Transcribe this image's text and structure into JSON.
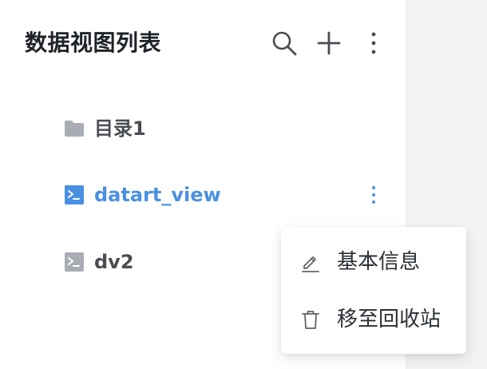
{
  "panel": {
    "title": "数据视图列表"
  },
  "header_actions": [
    {
      "name": "search-icon"
    },
    {
      "name": "plus-icon"
    },
    {
      "name": "more-vertical-icon"
    }
  ],
  "tree": {
    "items": [
      {
        "label": "目录1",
        "icon": "folder-icon",
        "active": false
      },
      {
        "label": "datart_view",
        "icon": "terminal-icon",
        "active": true
      },
      {
        "label": "dv2",
        "icon": "terminal-icon",
        "active": false
      }
    ]
  },
  "context_menu": {
    "items": [
      {
        "label": "基本信息",
        "icon": "edit-icon"
      },
      {
        "label": "移至回收站",
        "icon": "trash-icon"
      }
    ]
  },
  "colors": {
    "accent": "#4a90e2",
    "text": "#1f2329",
    "icon_gray": "#a9adb3",
    "background": "#f2f3f5"
  }
}
